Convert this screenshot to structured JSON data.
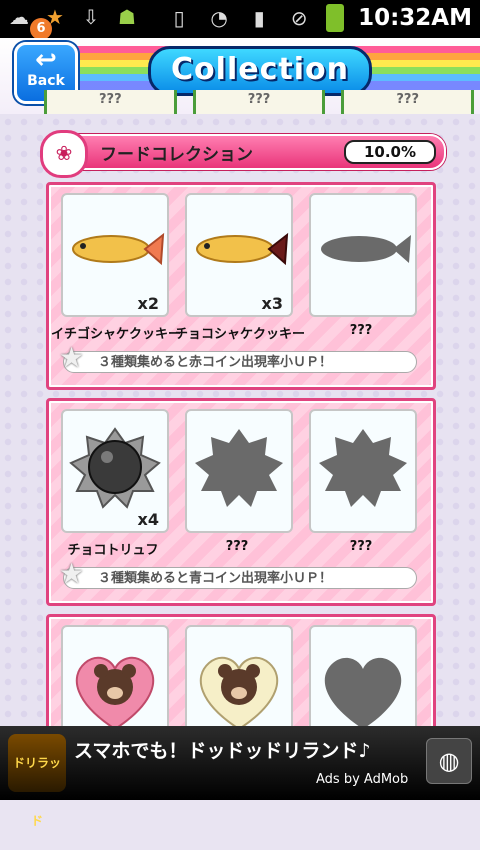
{
  "status_bar": {
    "notification_count": "6",
    "time": "10:32AM"
  },
  "header": {
    "back_label": "Back",
    "title": "Collection",
    "prev_labels": [
      "???",
      "???",
      "???"
    ]
  },
  "section": {
    "title": "フードコレクション",
    "percent": "10.0%"
  },
  "cards": [
    {
      "items": [
        {
          "name": "イチゴシャケクッキー",
          "count": "x2",
          "icon": "strawberry-fish-cookie-icon"
        },
        {
          "name": "チョコシャケクッキー",
          "count": "x3",
          "icon": "choco-fish-cookie-icon"
        },
        {
          "name": "???",
          "count": "",
          "icon": "fish-silhouette-icon"
        }
      ],
      "bonus": "３種類集めると赤コイン出現率小ＵＰ！"
    },
    {
      "items": [
        {
          "name": "チョコトリュフ",
          "count": "x4",
          "icon": "chocolate-truffle-icon"
        },
        {
          "name": "???",
          "count": "",
          "icon": "truffle-silhouette-icon"
        },
        {
          "name": "???",
          "count": "",
          "icon": "truffle-silhouette-icon"
        }
      ],
      "bonus": "３種類集めると青コイン出現率小ＵＰ！"
    },
    {
      "items": [
        {
          "name": "",
          "count": "",
          "icon": "bear-heart-cake-pink-icon"
        },
        {
          "name": "",
          "count": "",
          "icon": "bear-heart-cake-white-icon"
        },
        {
          "name": "",
          "count": "",
          "icon": "heart-silhouette-icon"
        }
      ],
      "bonus": ""
    }
  ],
  "ad": {
    "text": "スマホでも！ドッドッドリランド♪",
    "sub": "Ads by AdMob",
    "logo_text": "ドリラッド"
  },
  "colors": {
    "accent_pink": "#e0437f",
    "back_blue": "#0a6ee0",
    "title_blue": "#0a8ce8"
  }
}
